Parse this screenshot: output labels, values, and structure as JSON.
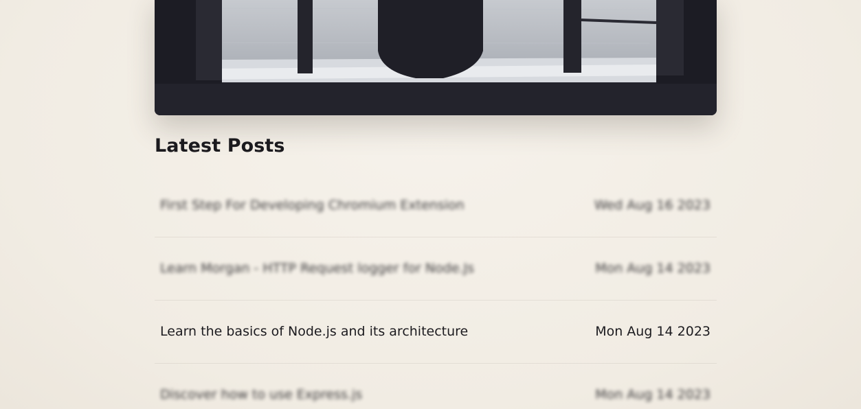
{
  "section": {
    "title": "Latest Posts"
  },
  "posts": [
    {
      "title": "First Step For Developing Chromium Extension",
      "date": "Wed Aug 16 2023",
      "blurred": true
    },
    {
      "title": "Learn Morgan - HTTP Request logger for Node.Js",
      "date": "Mon Aug 14 2023",
      "blurred": true
    },
    {
      "title": "Learn the basics of Node.js and its architecture",
      "date": "Mon Aug 14 2023",
      "blurred": false
    },
    {
      "title": "Discover how to use Express.js",
      "date": "Mon Aug 14 2023",
      "blurred": true
    }
  ],
  "colors": {
    "background": "#f4f0e8",
    "text": "#1c1b1f",
    "hero_dark": "#23232c"
  }
}
